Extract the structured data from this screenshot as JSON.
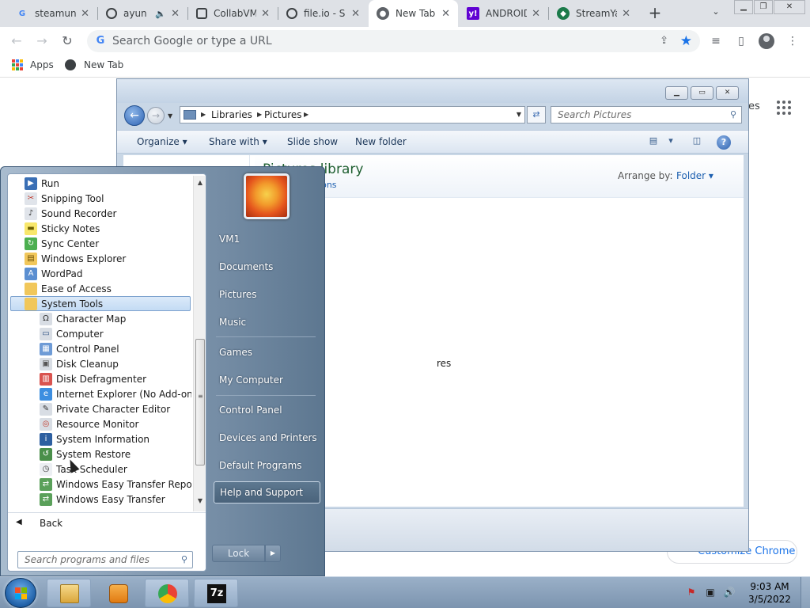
{
  "browser": {
    "tabs": [
      {
        "title": "steamun",
        "icon": "google-icon"
      },
      {
        "title": "ayun",
        "icon": "globe-icon"
      },
      {
        "title": "CollabVM",
        "icon": "collabvm-icon"
      },
      {
        "title": "file.io - S",
        "icon": "globe-icon"
      },
      {
        "title": "New Tab",
        "icon": "chrome-icon"
      },
      {
        "title": "ANDROID",
        "icon": "yahoo-icon"
      },
      {
        "title": "StreamYa",
        "icon": "streamyard-icon"
      }
    ],
    "active_tab": "New Tab",
    "omnibox_placeholder": "Search Google or type a URL",
    "bookmarks": [
      {
        "label": "Apps",
        "icon": "apps-grid-icon"
      },
      {
        "label": "New Tab",
        "icon": "globe-icon"
      }
    ],
    "ntp_right_text": "es",
    "customize_label": "Customize Chrome",
    "colors": {
      "tabstrip": "#dee1e6",
      "accent": "#1a73e8"
    }
  },
  "explorer": {
    "address": [
      "Libraries",
      "Pictures"
    ],
    "search_placeholder": "Search Pictures",
    "commands": [
      "Organize",
      "Share with",
      "Slide show",
      "New folder"
    ],
    "library_title": "Pictures library",
    "library_locations": "ations",
    "arrange_label": "Arrange by:",
    "arrange_value": "Folder",
    "partial_text": "res"
  },
  "start_menu": {
    "programs": [
      {
        "label": "Run",
        "icon": "run-icon",
        "indent": 0
      },
      {
        "label": "Snipping Tool",
        "icon": "scissors-icon",
        "indent": 0
      },
      {
        "label": "Sound Recorder",
        "icon": "microphone-icon",
        "indent": 0
      },
      {
        "label": "Sticky Notes",
        "icon": "sticky-note-icon",
        "indent": 0
      },
      {
        "label": "Sync Center",
        "icon": "sync-icon",
        "indent": 0
      },
      {
        "label": "Windows Explorer",
        "icon": "explorer-icon",
        "indent": 0
      },
      {
        "label": "WordPad",
        "icon": "wordpad-icon",
        "indent": 0
      },
      {
        "label": "Ease of Access",
        "icon": "folder-icon",
        "indent": 0
      },
      {
        "label": "System Tools",
        "icon": "folder-icon",
        "indent": 0,
        "selected": true
      },
      {
        "label": "Character Map",
        "icon": "character-map-icon",
        "indent": 1
      },
      {
        "label": "Computer",
        "icon": "computer-icon",
        "indent": 1
      },
      {
        "label": "Control Panel",
        "icon": "control-panel-icon",
        "indent": 1
      },
      {
        "label": "Disk Cleanup",
        "icon": "disk-cleanup-icon",
        "indent": 1
      },
      {
        "label": "Disk Defragmenter",
        "icon": "defragmenter-icon",
        "indent": 1
      },
      {
        "label": "Internet Explorer (No Add-ons)",
        "icon": "internet-explorer-icon",
        "indent": 1
      },
      {
        "label": "Private Character Editor",
        "icon": "character-editor-icon",
        "indent": 1
      },
      {
        "label": "Resource Monitor",
        "icon": "resource-monitor-icon",
        "indent": 1
      },
      {
        "label": "System Information",
        "icon": "system-info-icon",
        "indent": 1
      },
      {
        "label": "System Restore",
        "icon": "system-restore-icon",
        "indent": 1
      },
      {
        "label": "Task Scheduler",
        "icon": "clock-icon",
        "indent": 1
      },
      {
        "label": "Windows Easy Transfer Reports",
        "icon": "transfer-icon",
        "indent": 1
      },
      {
        "label": "Windows Easy Transfer",
        "icon": "transfer-icon",
        "indent": 1
      }
    ],
    "back_label": "Back",
    "search_placeholder": "Search programs and files",
    "right_items": [
      {
        "label": "VM1"
      },
      {
        "label": "Documents"
      },
      {
        "label": "Pictures"
      },
      {
        "label": "Music"
      },
      {
        "label": "Games"
      },
      {
        "label": "My Computer"
      },
      {
        "label": "Control Panel"
      },
      {
        "label": "Devices and Printers"
      },
      {
        "label": "Default Programs"
      },
      {
        "label": "Help and Support",
        "highlighted": true
      }
    ],
    "lock_label": "Lock"
  },
  "taskbar": {
    "pinned": [
      "explorer-icon",
      "media-player-icon",
      "chrome-icon",
      "7zip-icon"
    ],
    "pinned_7zip_label": "7z",
    "tray": [
      "action-center-icon",
      "network-icon",
      "volume-icon"
    ],
    "time": "9:03 AM",
    "date": "3/5/2022"
  }
}
